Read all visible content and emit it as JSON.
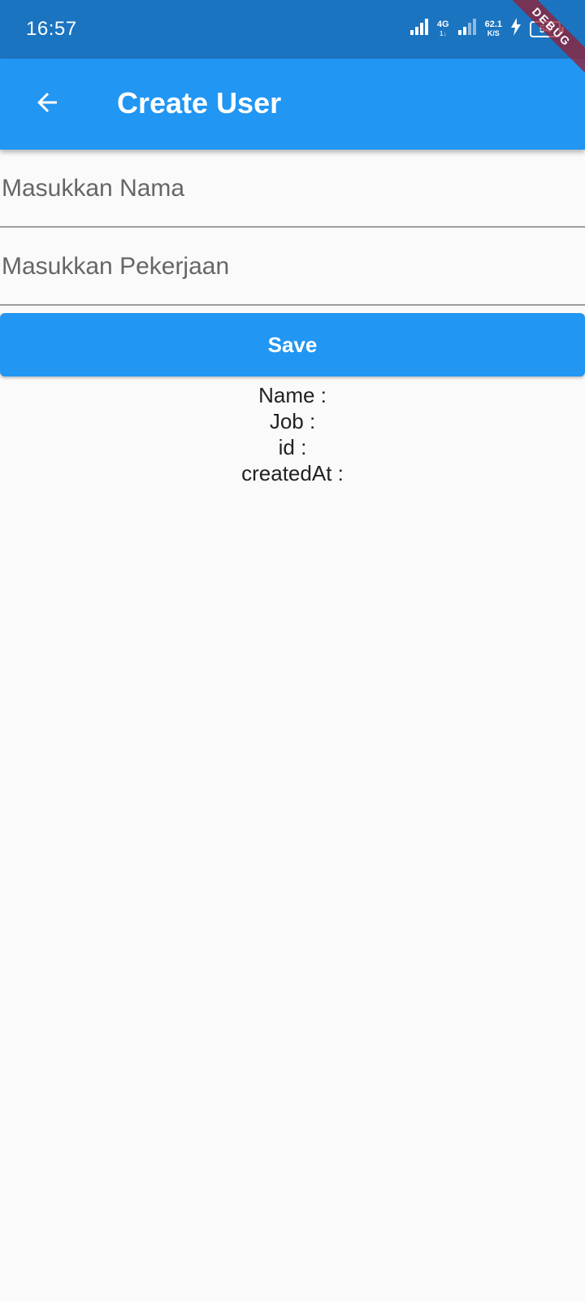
{
  "status_bar": {
    "time": "16:57",
    "network_type": "4G",
    "network_sub": "1↓",
    "speed_value": "62.1",
    "speed_unit": "K/S",
    "battery": "54",
    "debug_label": "DEBUG"
  },
  "app_bar": {
    "title": "Create User",
    "back_icon": "arrow-back-icon"
  },
  "form": {
    "name_placeholder": "Masukkan Nama",
    "name_value": "",
    "job_placeholder": "Masukkan Pekerjaan",
    "job_value": "",
    "save_label": "Save"
  },
  "result": {
    "name_line": "Name :",
    "job_line": "Job :",
    "id_line": "id :",
    "created_line": "createdAt :"
  },
  "colors": {
    "status_bar": "#1b74c0",
    "primary": "#2196f3",
    "background": "#fafafa"
  }
}
